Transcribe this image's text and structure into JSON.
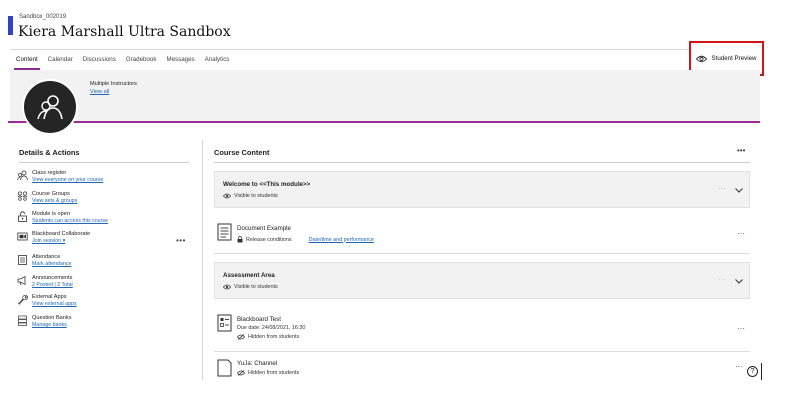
{
  "course": {
    "id": "Sandbox_002019",
    "title": "Kiera Marshall Ultra Sandbox"
  },
  "tabs": [
    {
      "label": "Content",
      "active": true
    },
    {
      "label": "Calendar",
      "active": false
    },
    {
      "label": "Discussions",
      "active": false
    },
    {
      "label": "Gradebook",
      "active": false
    },
    {
      "label": "Messages",
      "active": false
    },
    {
      "label": "Analytics",
      "active": false
    }
  ],
  "student_preview": {
    "label": "Student Preview",
    "icon": "eye-preview-icon"
  },
  "banner": {
    "instructors_label": "Multiple Instructors",
    "view_all": "View all"
  },
  "details": {
    "title": "Details & Actions",
    "items": [
      {
        "icon": "class-register-icon",
        "title": "Class register",
        "link": "View everyone on your course"
      },
      {
        "icon": "course-groups-icon",
        "title": "Course Groups",
        "link": "View sets & groups"
      },
      {
        "icon": "lock-open-icon",
        "title": "Module is open",
        "link": "Students can access this course"
      },
      {
        "icon": "collaborate-icon",
        "title": "Blackboard Collaborate",
        "link": "Join session  ▾"
      },
      {
        "icon": "attendance-icon",
        "title": "Attendance",
        "link": "Mark attendance"
      },
      {
        "icon": "megaphone-icon",
        "title": "Announcements",
        "link": "2 Posted | 2 Total"
      },
      {
        "icon": "wrench-icon",
        "title": "External Apps",
        "link": "View external apps"
      },
      {
        "icon": "question-bank-icon",
        "title": "Question Banks",
        "link": "Manage banks"
      }
    ],
    "more": "•••"
  },
  "content": {
    "title": "Course Content",
    "more": "•••",
    "welcome_module": {
      "title": "Welcome to <<This module>>",
      "visibility": "Visible to students"
    },
    "document": {
      "title": "Document Example",
      "release": "Release conditions",
      "date_link": "Date/time and performance"
    },
    "assessment_module": {
      "title": "Assessment Area",
      "visibility": "Visible to students"
    },
    "test": {
      "title": "Blackboard Test",
      "due": "Due date: 24/08/2021, 16:30",
      "visibility": "Hidden from students"
    },
    "yuja": {
      "title": "YuJa: Channel",
      "visibility": "Hidden from students"
    }
  },
  "help": {
    "label": "?"
  }
}
